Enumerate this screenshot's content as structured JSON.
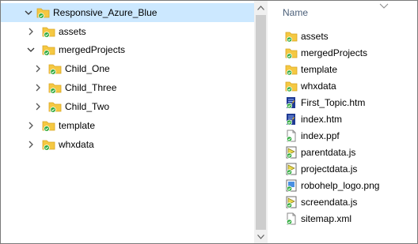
{
  "tree": {
    "items": [
      {
        "label": "Responsive_Azure_Blue",
        "expanded": true,
        "selected": true,
        "depth": 0
      },
      {
        "label": "assets",
        "expanded": false,
        "depth": 1
      },
      {
        "label": "mergedProjects",
        "expanded": true,
        "depth": 1
      },
      {
        "label": "Child_One",
        "expanded": false,
        "depth": 2
      },
      {
        "label": "Child_Three",
        "expanded": false,
        "depth": 2
      },
      {
        "label": "Child_Two",
        "expanded": false,
        "depth": 2
      },
      {
        "label": "template",
        "expanded": false,
        "depth": 1
      },
      {
        "label": "whxdata",
        "expanded": false,
        "depth": 1
      }
    ]
  },
  "files": {
    "column_header": "Name",
    "items": [
      {
        "label": "assets",
        "icon": "folder-icon"
      },
      {
        "label": "mergedProjects",
        "icon": "folder-icon"
      },
      {
        "label": "template",
        "icon": "folder-icon"
      },
      {
        "label": "whxdata",
        "icon": "folder-icon"
      },
      {
        "label": "First_Topic.htm",
        "icon": "htm-file-icon"
      },
      {
        "label": "index.htm",
        "icon": "htm-file-icon"
      },
      {
        "label": "index.ppf",
        "icon": "generic-file-icon"
      },
      {
        "label": "parentdata.js",
        "icon": "js-file-icon"
      },
      {
        "label": "projectdata.js",
        "icon": "js-file-icon"
      },
      {
        "label": "robohelp_logo.png",
        "icon": "png-file-icon"
      },
      {
        "label": "screendata.js",
        "icon": "js-file-icon"
      },
      {
        "label": "sitemap.xml",
        "icon": "generic-file-icon"
      }
    ]
  },
  "colors": {
    "selection": "#cce8ff",
    "folder": "#f5c842",
    "sync_badge": "#2eaa3c",
    "header_text": "#4c607a"
  }
}
